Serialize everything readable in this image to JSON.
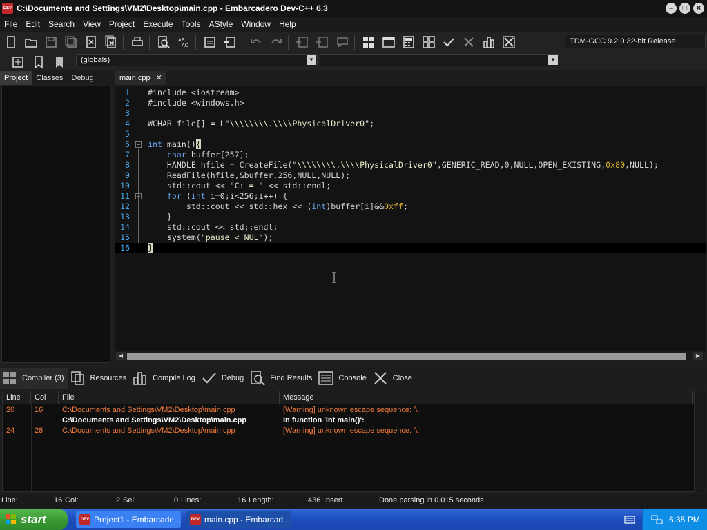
{
  "window": {
    "title": "C:\\Documents and Settings\\VM2\\Desktop\\main.cpp - Embarcadero Dev-C++ 6.3",
    "icon_label": "DEV C++"
  },
  "menu": [
    "File",
    "Edit",
    "Search",
    "View",
    "Project",
    "Execute",
    "Tools",
    "AStyle",
    "Window",
    "Help"
  ],
  "toolbar": {
    "compiler": "TDM-GCC 9.2.0 32-bit Release",
    "scope": "(globals)"
  },
  "left_panel": {
    "tabs": [
      "Project",
      "Classes",
      "Debug"
    ]
  },
  "editor": {
    "tab": "main.cpp",
    "tab_close": "✕",
    "line_numbers": [
      "1",
      "2",
      "3",
      "4",
      "5",
      "6",
      "7",
      "8",
      "9",
      "10",
      "11",
      "12",
      "13",
      "14",
      "15",
      "16"
    ]
  },
  "bottom_panel": {
    "tabs": [
      "Compiler (3)",
      "Resources",
      "Compile Log",
      "Debug",
      "Find Results",
      "Console",
      "Close"
    ],
    "columns": [
      "Line",
      "Col",
      "File",
      "Message"
    ],
    "rows": [
      {
        "line": "20",
        "col": "16",
        "file": "C:\\Documents and Settings\\VM2\\Desktop\\main.cpp",
        "message": "[Warning] unknown escape sequence: '\\.'",
        "kind": "warning"
      },
      {
        "line": "",
        "col": "",
        "file": "C:\\Documents and Settings\\VM2\\Desktop\\main.cpp",
        "message": "In function 'int main()':",
        "kind": "info"
      },
      {
        "line": "24",
        "col": "28",
        "file": "C:\\Documents and Settings\\VM2\\Desktop\\main.cpp",
        "message": "[Warning] unknown escape sequence: '\\.'",
        "kind": "warning"
      }
    ]
  },
  "status": {
    "line_label": "Line:",
    "line_value": "16",
    "col_label": "Col:",
    "col_value": "2",
    "sel_label": "Sel:",
    "sel_value": "0",
    "lines_label": "Lines:",
    "lines_value": "16",
    "length_label": "Length:",
    "length_value": "436",
    "mode": "Insert",
    "message": "Done parsing in 0.015 seconds"
  },
  "taskbar": {
    "start": "start",
    "tasks": [
      "Project1 - Embarcade...",
      "main.cpp - Embarcad..."
    ],
    "clock": "6:35 PM"
  },
  "colors": {
    "warning": "#f07a3c",
    "line_number": "#47a6e8",
    "keyword": "#66a8ee",
    "number": "#e0b830"
  }
}
